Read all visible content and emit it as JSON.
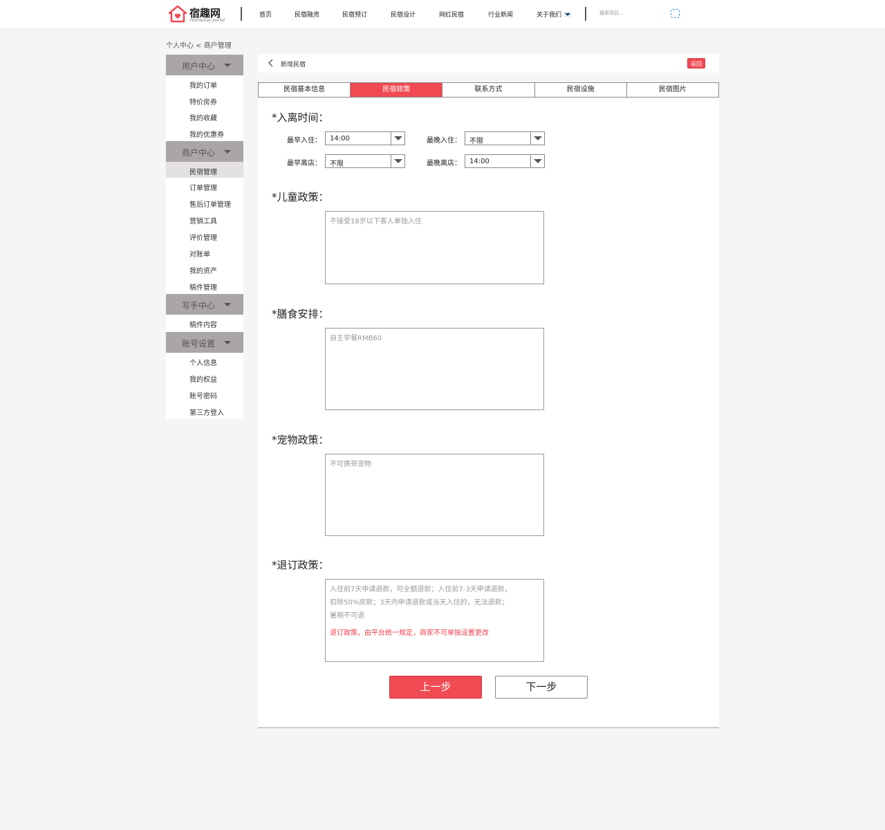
{
  "header": {
    "logo_text": "宿趣网",
    "logo_sub": "Homestay portal",
    "nav": [
      "首页",
      "民宿融资",
      "民宿预订",
      "民宿设计",
      "网红民宿",
      "行业新闻",
      "关于我们"
    ],
    "search_placeholder": "搜索项目...",
    "colors": {
      "brand": "#f04a52"
    }
  },
  "breadcrumb": {
    "text": "个人中心 < 商户管理"
  },
  "sidebar": {
    "user_center": {
      "title": "用户中心",
      "items": [
        "我的订单",
        "特价房券",
        "我的收藏",
        "我的优惠券"
      ]
    },
    "merchant_center": {
      "title": "商户中心",
      "items": [
        "民宿管理",
        "订单管理",
        "售后订单管理",
        "营销工具",
        "评价管理",
        "对账单",
        "我的资产",
        "稿件管理"
      ]
    },
    "writer_center": {
      "title": "写手中心",
      "items": [
        "稿件内容"
      ]
    },
    "account_settings": {
      "title": "账号设置",
      "items": [
        "个人信息",
        "我的权益",
        "账号密码",
        "第三方登入"
      ]
    }
  },
  "main": {
    "title": "新增民宿",
    "return_label": "返回",
    "tabs": [
      "民宿基本信息",
      "民宿政策",
      "联系方式",
      "民宿设施",
      "民宿图片"
    ],
    "checkin": {
      "title": "*入离时间：",
      "earliest_in_label": "最早入住：",
      "earliest_in_value": "14:00",
      "latest_in_label": "最晚入住：",
      "latest_in_value": "不限",
      "earliest_out_label": "最早离店：",
      "earliest_out_value": "不限",
      "latest_out_label": "最晚离店：",
      "latest_out_value": "14:00"
    },
    "children": {
      "title": "*儿童政策：",
      "placeholder": "不接受18岁以下客人单独入住"
    },
    "meals": {
      "title": "*膳食安排：",
      "placeholder": "自主早餐RMB60"
    },
    "pets": {
      "title": "*宠物政策：",
      "placeholder": "不可携带宠物"
    },
    "refund": {
      "title": "*退订政策：",
      "text_lines": [
        "入住前7天申请退款，可全额退款；入住前7-3天申请退款，",
        "扣除50%房款；3天内申请退款或当天入住的，无法退款；",
        "暑期不可退"
      ],
      "warning": "退订政策，由平台统一规定，商家不可单独设置更改"
    },
    "prev_label": "上一步",
    "next_label": "下一步"
  }
}
